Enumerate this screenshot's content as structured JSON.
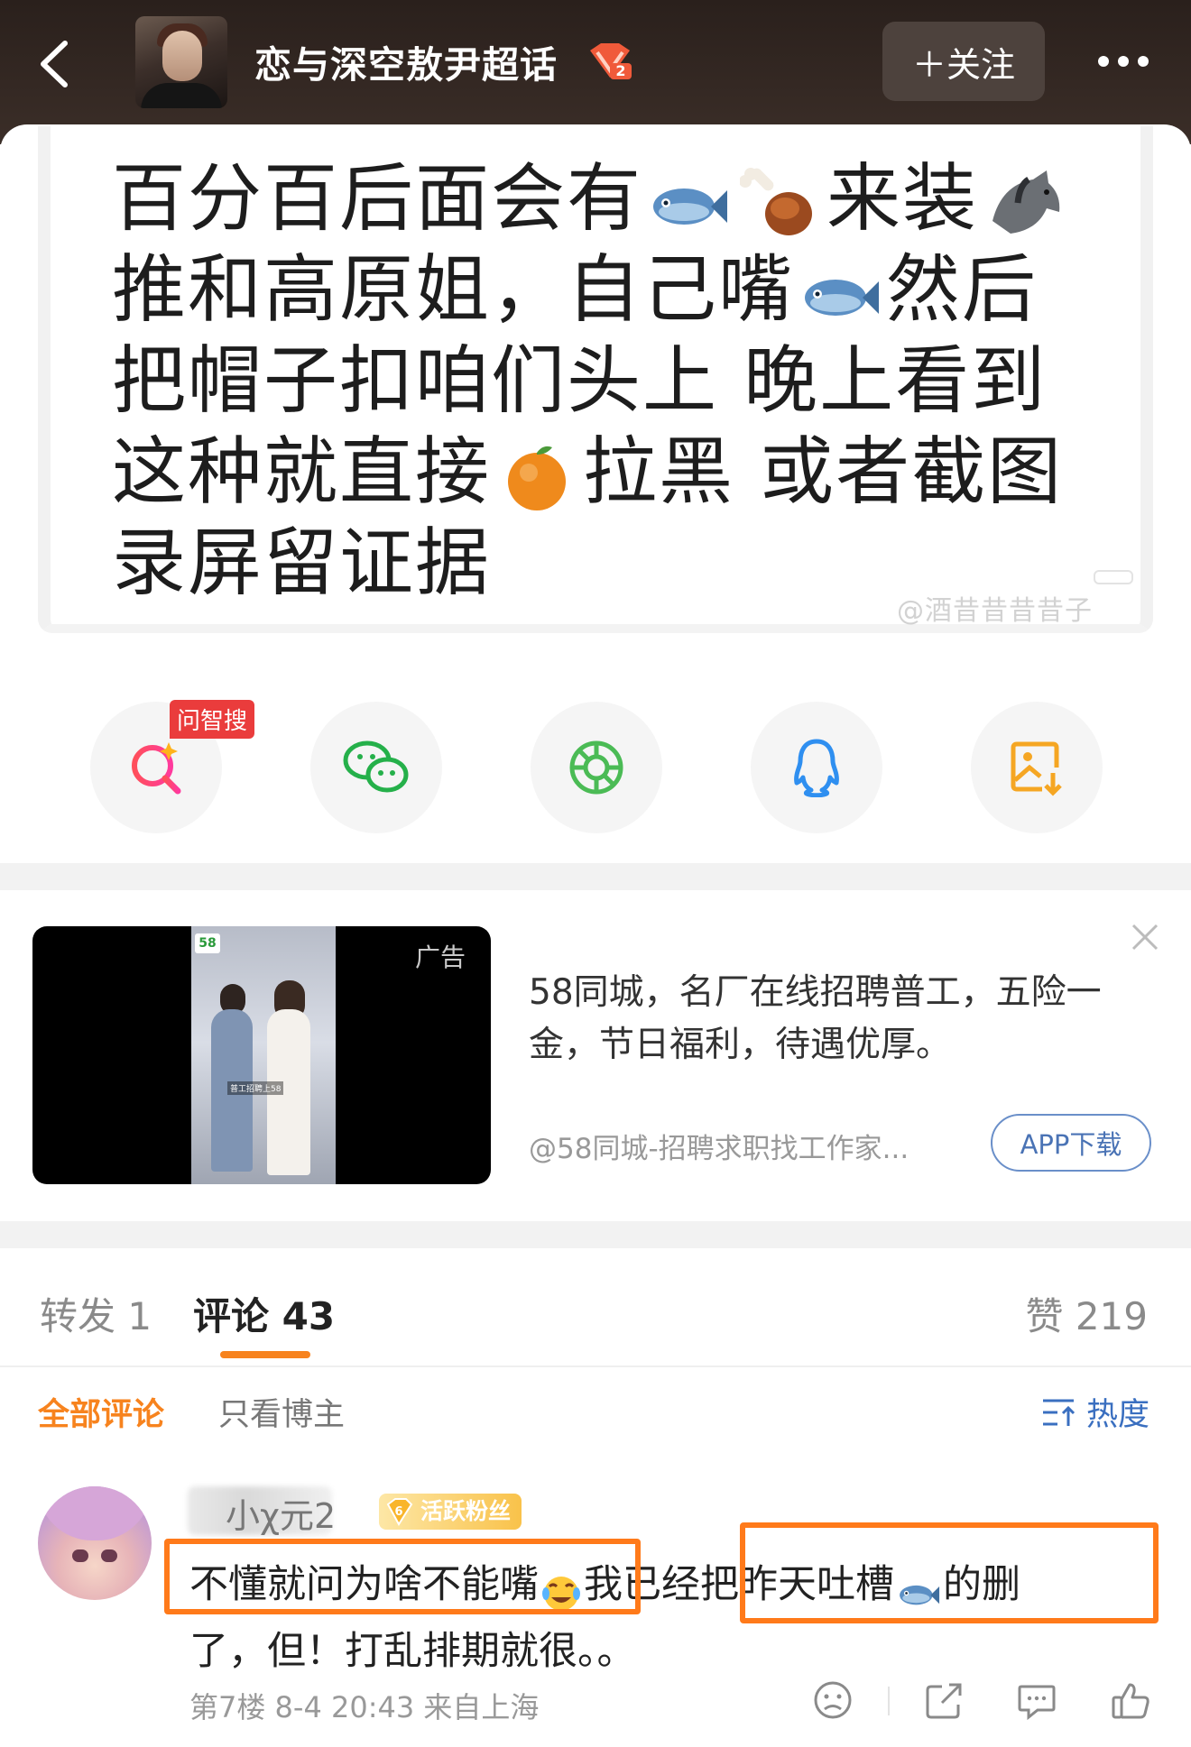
{
  "header": {
    "title": "恋与深空敖尹超话",
    "follow_label": "＋关注",
    "level_badge": "2"
  },
  "post": {
    "lines": [
      [
        "百分百后面会有",
        "fish",
        "drumstick",
        "来装",
        "horse"
      ],
      [
        "推和高原姐，自己嘴",
        "fish",
        "然后"
      ],
      [
        "把帽子扣咱们头上 晚上看到"
      ],
      [
        "这种就直接",
        "orange",
        "拉黑 或者截图"
      ],
      [
        "录屏留证据"
      ]
    ],
    "line1_a": "百分百后面会有",
    "line1_b": "来装",
    "line2_a": "推和高原姐，自己嘴",
    "line2_b": "然后",
    "line3": "把帽子扣咱们头上 晚上看到",
    "line4_a": "这种就直接",
    "line4_b": "拉黑 或者截图",
    "line5": "录屏留证据",
    "watermark": "@酒昔昔昔昔子"
  },
  "share": {
    "search_tag": "问智搜",
    "buttons": [
      "search-ai-icon",
      "wechat-icon",
      "moments-icon",
      "qq-icon",
      "save-image-icon"
    ]
  },
  "ad": {
    "label": "广告",
    "logo": "58",
    "caption": "普工招聘上58",
    "text": "58同城，名厂在线招聘普工，五险一金，节日福利，待遇优厚。",
    "source": "@58同城-招聘求职找工作家...",
    "download_label": "APP下载"
  },
  "tabs": {
    "repost": "转发 1",
    "comments": "评论 43",
    "likes": "赞 219"
  },
  "filters": {
    "all": "全部评论",
    "author_only": "只看博主",
    "sort": "热度"
  },
  "comment": {
    "name": "小χ元2",
    "fan_level": "6",
    "fan_badge": "活跃粉丝",
    "text_part1": "不懂就问为啥不能嘴",
    "text_part2": "我已经",
    "text_part3": "把昨天吐槽",
    "text_part4": "的删",
    "text_part5": "了，但！打乱排期就很。。",
    "meta": "第7楼  8-4 20:43  来自上海"
  },
  "colors": {
    "accent": "#f7831e",
    "highlight_box": "#ff7a1a",
    "link_blue": "#3a6fc0",
    "header_bg": "#2a201c"
  }
}
